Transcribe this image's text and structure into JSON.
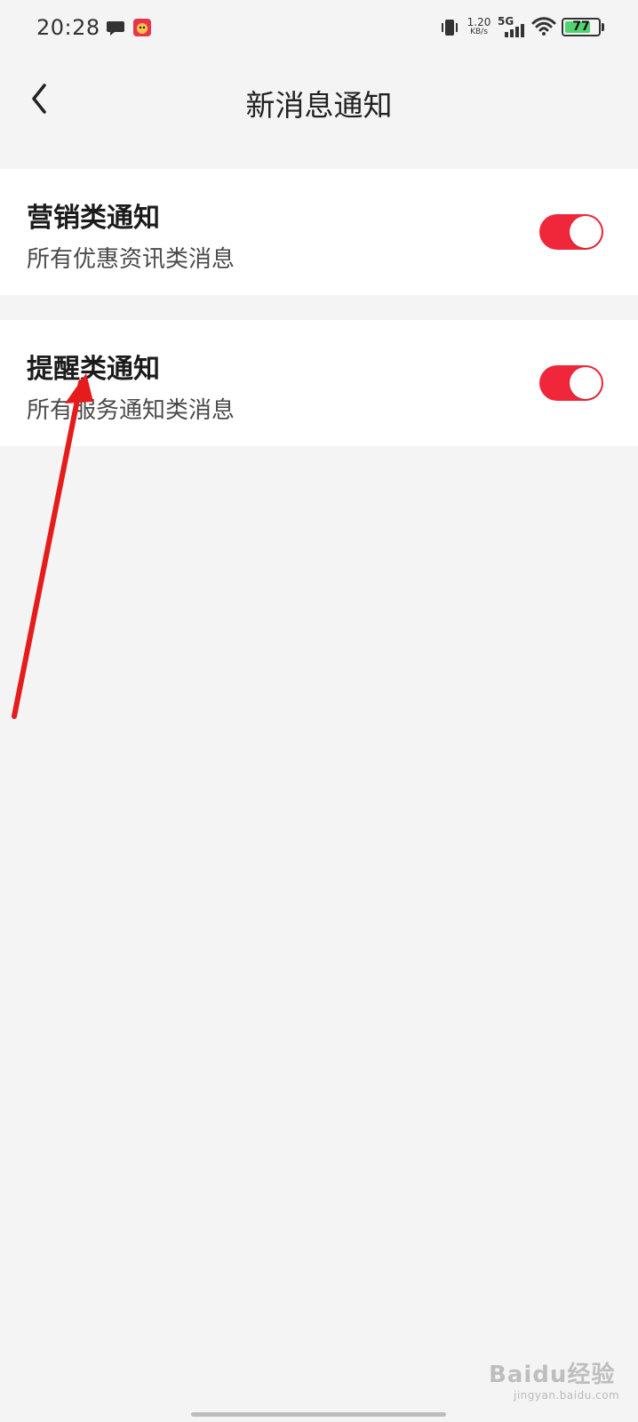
{
  "status_bar": {
    "time": "20:28",
    "network_speed_value": "1.20",
    "network_speed_unit": "KB/s",
    "network_type": "5G",
    "battery_percent": 77,
    "battery_label": "77"
  },
  "header": {
    "title": "新消息通知"
  },
  "settings": [
    {
      "title": "营销类通知",
      "description": "所有优惠资讯类消息",
      "enabled": true
    },
    {
      "title": "提醒类通知",
      "description": "所有服务通知类消息",
      "enabled": true
    }
  ],
  "colors": {
    "toggle_on": "#f0273a",
    "background": "#f4f4f4",
    "card_background": "#ffffff",
    "annotation_arrow": "#e61b1b",
    "battery_fill": "#53d36f"
  },
  "watermark": {
    "brand": "Baidu经验",
    "url": "jingyan.baidu.com"
  },
  "icons": {
    "back": "chevron-left-icon",
    "chat": "chat-bubble-icon",
    "app": "app-notification-icon",
    "vibrate": "vibrate-icon",
    "signal": "signal-bars-icon",
    "wifi": "wifi-icon",
    "battery": "battery-icon"
  }
}
